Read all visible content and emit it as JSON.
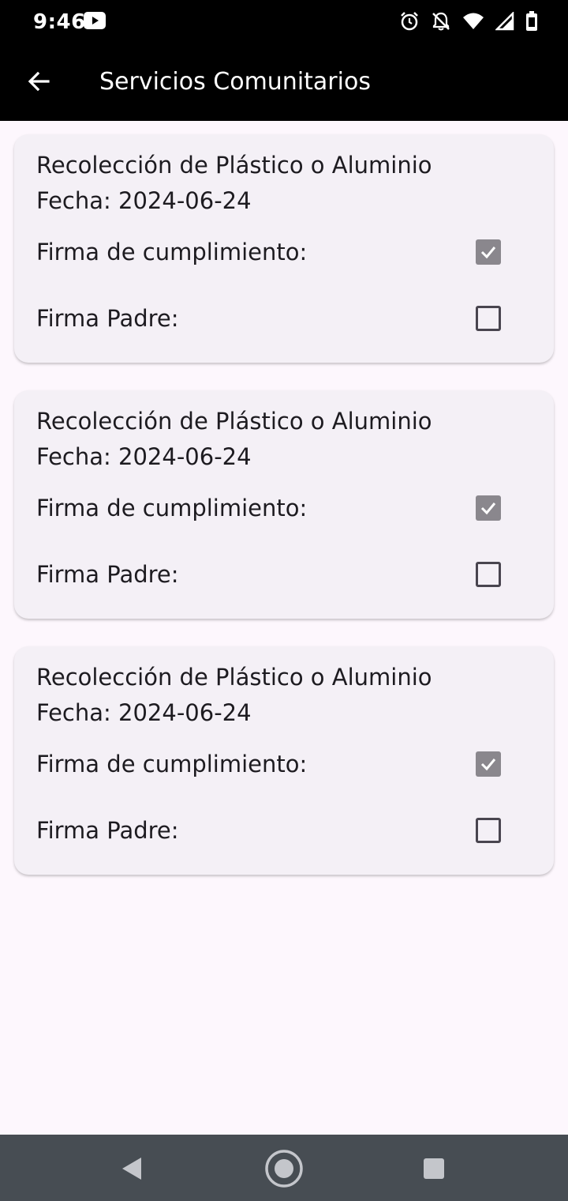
{
  "status_bar": {
    "time": "9:46",
    "icons": [
      "youtube-icon",
      "alarm-icon",
      "notifications-off-icon",
      "wifi-icon",
      "signal-icon",
      "battery-icon"
    ]
  },
  "app_bar": {
    "title": "Servicios Comunitarios",
    "back_icon": "arrow-back-icon"
  },
  "cards": [
    {
      "title": "Recolección de Plástico o Aluminio",
      "date": "Fecha: 2024-06-24",
      "compliance_label": "Firma de cumplimiento:",
      "compliance_checked": true,
      "parent_label": "Firma Padre:",
      "parent_checked": false
    },
    {
      "title": "Recolección de Plástico o Aluminio",
      "date": "Fecha: 2024-06-24",
      "compliance_label": "Firma de cumplimiento:",
      "compliance_checked": true,
      "parent_label": "Firma Padre:",
      "parent_checked": false
    },
    {
      "title": "Recolección de Plástico o Aluminio",
      "date": "Fecha: 2024-06-24",
      "compliance_label": "Firma de cumplimiento:",
      "compliance_checked": true,
      "parent_label": "Firma Padre:",
      "parent_checked": false
    }
  ],
  "nav_bar": {
    "buttons": [
      "back-triangle-icon",
      "home-circle-icon",
      "recents-square-icon"
    ]
  },
  "colors": {
    "app_bar": "#000000",
    "background": "#fdf7fd",
    "card": "#f4f0f6",
    "checkbox_disabled": "#8a878d",
    "nav_bar": "#474d53"
  }
}
